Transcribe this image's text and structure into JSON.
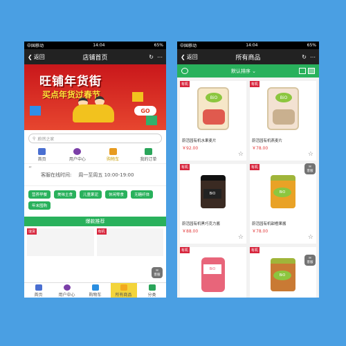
{
  "status": {
    "carrier": "中国移动",
    "time": "14:04",
    "battery": "65%"
  },
  "left": {
    "nav": {
      "back": "返回",
      "title": "店铺首页"
    },
    "banner": {
      "title": "旺铺年货街",
      "subtitle": "买点年货过春节",
      "go": "GO"
    },
    "search_placeholder": "蔚然之家",
    "tabs": [
      {
        "label": "首页",
        "icon": "home-icon"
      },
      {
        "label": "用户中心",
        "icon": "user-icon"
      },
      {
        "label": "购物车",
        "icon": "cart-icon"
      },
      {
        "label": "我的订单",
        "icon": "order-icon"
      }
    ],
    "hours": {
      "label": "客服在线时间:",
      "value": "周一至周五 10:00-19:00"
    },
    "tags": [
      "营养早餐",
      "美味主食",
      "儿童果泥",
      "休闲零食",
      "无糖纤体",
      "年末囤购"
    ],
    "hot_title": "爆款推荐",
    "hot_tags": [
      "谜货",
      "有机"
    ],
    "kefu": "客服",
    "bottom_nav": [
      {
        "label": "首页",
        "icon": "home-icon"
      },
      {
        "label": "用户中心",
        "icon": "user-icon"
      },
      {
        "label": "购物车",
        "icon": "cart-icon"
      },
      {
        "label": "所有商品",
        "icon": "goods-icon"
      },
      {
        "label": "分类",
        "icon": "menu-icon"
      }
    ]
  },
  "right": {
    "nav": {
      "back": "返回",
      "title": "所有商品"
    },
    "sort": "默认排序",
    "tag": "有机",
    "kefu": "客服",
    "products": [
      {
        "name": "蔚活园有机水果麦片",
        "price": "￥92.00",
        "brand": "BiO",
        "color": "#f6e7c8"
      },
      {
        "name": "蔚活园有机燕麦片",
        "price": "￥78.00",
        "brand": "BiO",
        "color": "#f3e2d2"
      },
      {
        "name": "蔚活园有机黑巧克力酱",
        "price": "￥88.00",
        "brand": "BiO",
        "color": "#3a2a22"
      },
      {
        "name": "蔚活园有机甜橙果酱",
        "price": "￥78.00",
        "brand": "BiO",
        "color": "#e9a226"
      },
      {
        "name": "",
        "price": "",
        "brand": "BiO",
        "color": "#e8657a"
      },
      {
        "name": "",
        "price": "",
        "brand": "BiO",
        "color": "#c97a34"
      }
    ]
  }
}
